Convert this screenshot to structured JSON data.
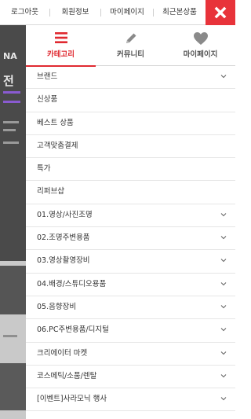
{
  "topbar": {
    "links": [
      "로그아웃",
      "회원정보",
      "마이페이지",
      "최근본상품"
    ]
  },
  "tabs": [
    {
      "label": "카테고리",
      "icon": "hamburger-icon",
      "active": true
    },
    {
      "label": "커뮤니티",
      "icon": "pencil-icon",
      "active": false
    },
    {
      "label": "마이페이지",
      "icon": "heart-icon",
      "active": false
    }
  ],
  "menu": {
    "items": [
      {
        "label": "브랜드",
        "expandable": true
      },
      {
        "label": "신상품",
        "expandable": false
      },
      {
        "label": "베스트 상품",
        "expandable": false
      },
      {
        "label": "고객맞춤결제",
        "expandable": false
      },
      {
        "label": "특가",
        "expandable": false
      },
      {
        "label": "리퍼브샵",
        "expandable": false
      },
      {
        "label": "01.영상/사진조명",
        "expandable": true
      },
      {
        "label": "02.조명주변용품",
        "expandable": true
      },
      {
        "label": "03.영상촬영장비",
        "expandable": true
      },
      {
        "label": "04.배경/스튜디오용품",
        "expandable": true
      },
      {
        "label": "05.음향장비",
        "expandable": true
      },
      {
        "label": "06.PC주변용품/디지털",
        "expandable": true
      },
      {
        "label": "크리에이터 마켓",
        "expandable": true
      },
      {
        "label": "코스메틱/소품/렌탈",
        "expandable": true
      },
      {
        "label": "[이벤트]사라모닉 행사",
        "expandable": true
      }
    ]
  },
  "colors": {
    "accent": "#e02a31",
    "close_bg": "#e8333a"
  }
}
